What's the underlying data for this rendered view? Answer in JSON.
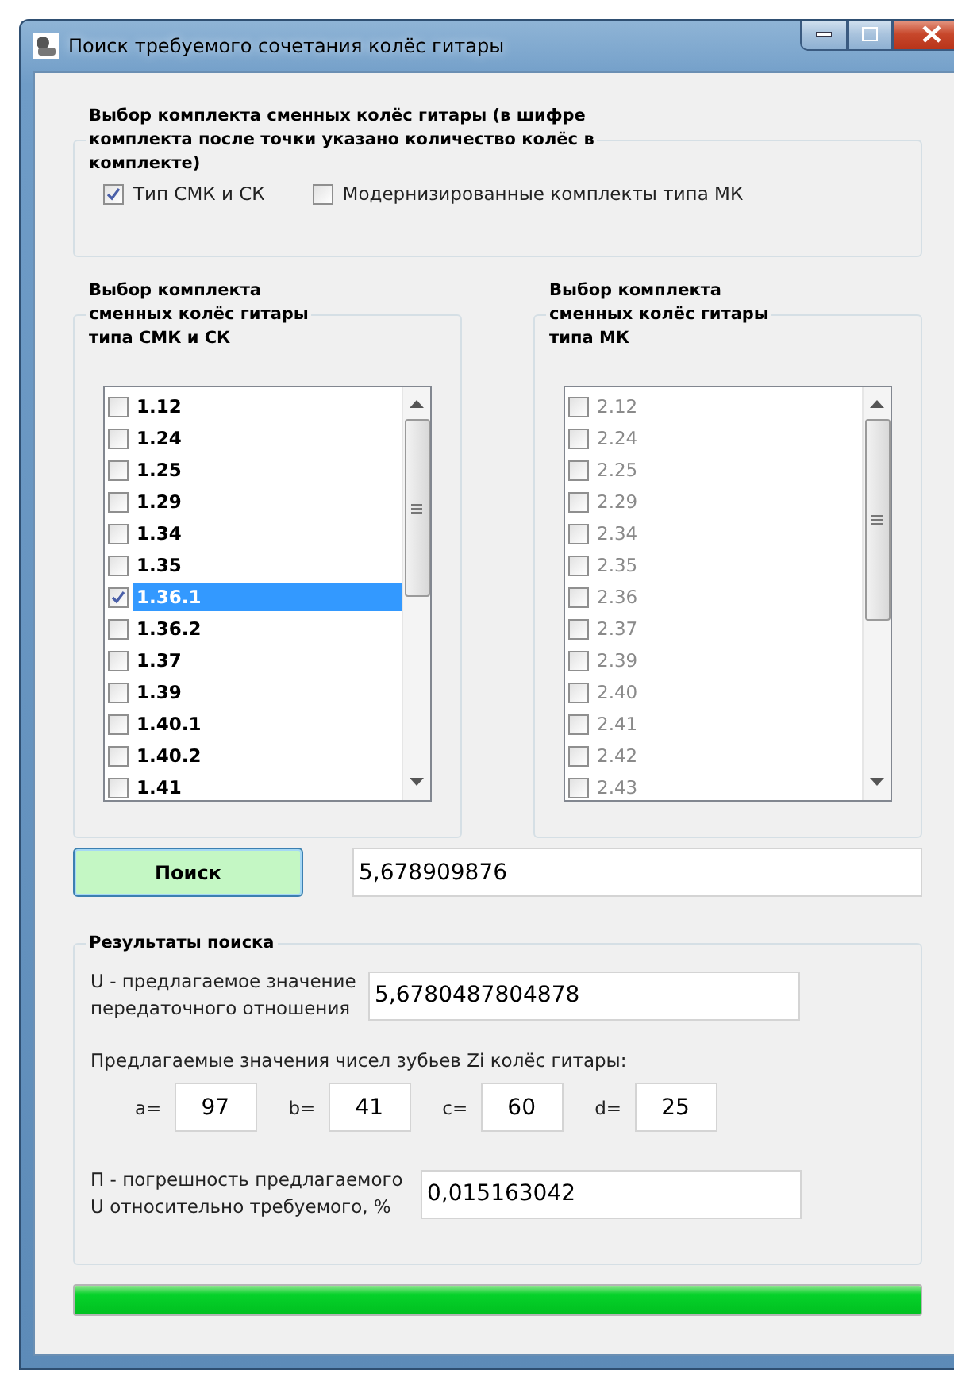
{
  "window": {
    "title": "Поиск требуемого сочетания колёс гитары"
  },
  "kit_group": {
    "title_lines": [
      "Выбор комплекта сменных колёс гитары (в шифре",
      "комплекта после точки указано количество колёс в",
      "комплекте)"
    ],
    "options": [
      {
        "label": "Тип СМК и СК",
        "checked": true
      },
      {
        "label": "Модернизированные комплекты типа МК",
        "checked": false
      }
    ]
  },
  "lists": [
    {
      "title_lines": [
        "Выбор комплекта",
        "сменных колёс гитары",
        "типа СМК и СК"
      ],
      "disabled": false,
      "items": [
        {
          "label": "1.12",
          "checked": false,
          "selected": false
        },
        {
          "label": "1.24",
          "checked": false,
          "selected": false
        },
        {
          "label": "1.25",
          "checked": false,
          "selected": false
        },
        {
          "label": "1.29",
          "checked": false,
          "selected": false
        },
        {
          "label": "1.34",
          "checked": false,
          "selected": false
        },
        {
          "label": "1.35",
          "checked": false,
          "selected": false
        },
        {
          "label": "1.36.1",
          "checked": true,
          "selected": true
        },
        {
          "label": "1.36.2",
          "checked": false,
          "selected": false
        },
        {
          "label": "1.37",
          "checked": false,
          "selected": false
        },
        {
          "label": "1.39",
          "checked": false,
          "selected": false
        },
        {
          "label": "1.40.1",
          "checked": false,
          "selected": false
        },
        {
          "label": "1.40.2",
          "checked": false,
          "selected": false
        },
        {
          "label": "1.41",
          "checked": false,
          "selected": false
        }
      ]
    },
    {
      "title_lines": [
        "Выбор комплекта",
        "сменных колёс гитары",
        "типа МК"
      ],
      "disabled": true,
      "items": [
        {
          "label": "2.12",
          "checked": false,
          "selected": false
        },
        {
          "label": "2.24",
          "checked": false,
          "selected": false
        },
        {
          "label": "2.25",
          "checked": false,
          "selected": false
        },
        {
          "label": "2.29",
          "checked": false,
          "selected": false
        },
        {
          "label": "2.34",
          "checked": false,
          "selected": false
        },
        {
          "label": "2.35",
          "checked": false,
          "selected": false
        },
        {
          "label": "2.36",
          "checked": false,
          "selected": false
        },
        {
          "label": "2.37",
          "checked": false,
          "selected": false
        },
        {
          "label": "2.39",
          "checked": false,
          "selected": false
        },
        {
          "label": "2.40",
          "checked": false,
          "selected": false
        },
        {
          "label": "2.41",
          "checked": false,
          "selected": false
        },
        {
          "label": "2.42",
          "checked": false,
          "selected": false
        },
        {
          "label": "2.43",
          "checked": false,
          "selected": false
        }
      ]
    }
  ],
  "search": {
    "button": "Поиск",
    "value": "5,678909876"
  },
  "results": {
    "title": "Результаты поиска",
    "u_label_lines": [
      "U - предлагаемое значение",
      "передаточного отношения"
    ],
    "u_value": "5,6780487804878",
    "teeth_label": "Предлагаемые значения чисел зубьев Zi колёс гитары:",
    "teeth": [
      {
        "label": "a=",
        "value": "97"
      },
      {
        "label": "b=",
        "value": "41"
      },
      {
        "label": "c=",
        "value": "60"
      },
      {
        "label": "d=",
        "value": "25"
      }
    ],
    "error_label_lines": [
      "П - погрешность предлагаемого",
      "U относительно требуемого, %"
    ],
    "error_value": "0,015163042"
  },
  "progress": {
    "level": 1
  }
}
